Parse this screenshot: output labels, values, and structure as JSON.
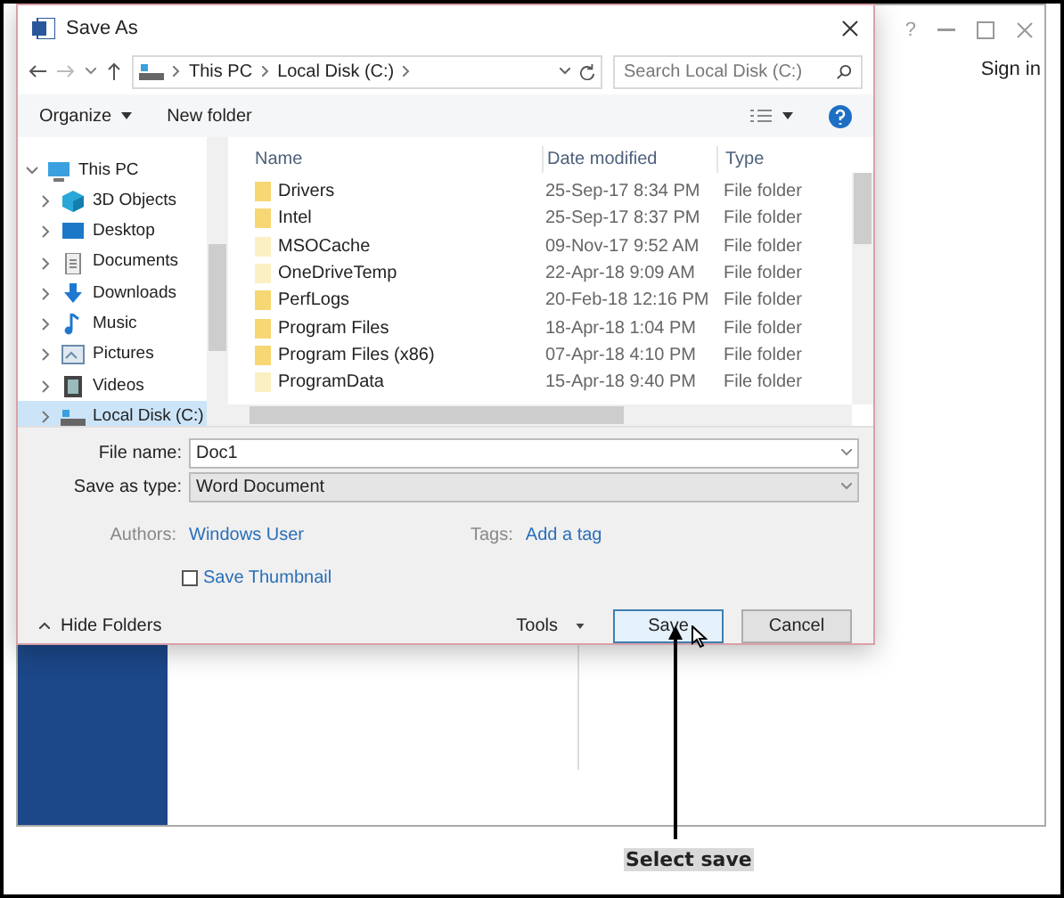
{
  "background_window": {
    "help": "?",
    "sign_in": "Sign in"
  },
  "dialog": {
    "title": "Save As",
    "path": [
      "This PC",
      "Local Disk (C:)"
    ],
    "search": {
      "placeholder": "Search Local Disk (C:)"
    },
    "toolbar": [
      "Organize",
      "New folder"
    ],
    "nav": [
      {
        "label": "This PC",
        "kind": "pc",
        "expanded": true,
        "selected": false,
        "children": [
          {
            "label": "3D Objects",
            "kind": "cube",
            "expanded": false,
            "selected": false
          },
          {
            "label": "Desktop",
            "kind": "desktop",
            "expanded": false,
            "selected": false
          },
          {
            "label": "Documents",
            "kind": "documents",
            "expanded": false,
            "selected": false
          },
          {
            "label": "Downloads",
            "kind": "downloads",
            "expanded": false,
            "selected": false
          },
          {
            "label": "Music",
            "kind": "music",
            "expanded": false,
            "selected": false
          },
          {
            "label": "Pictures",
            "kind": "pictures",
            "expanded": false,
            "selected": false
          },
          {
            "label": "Videos",
            "kind": "videos",
            "expanded": false,
            "selected": false
          },
          {
            "label": "Local Disk (C:)",
            "kind": "drive",
            "expanded": false,
            "selected": true
          }
        ]
      }
    ],
    "columns": [
      "Name",
      "Date modified",
      "Type"
    ],
    "files": [
      {
        "name": "Drivers",
        "date": "25-Sep-17 8:34 PM",
        "type": "File folder",
        "faded": false
      },
      {
        "name": "Intel",
        "date": "25-Sep-17 8:37 PM",
        "type": "File folder",
        "faded": false
      },
      {
        "name": "MSOCache",
        "date": "09-Nov-17 9:52 AM",
        "type": "File folder",
        "faded": true
      },
      {
        "name": "OneDriveTemp",
        "date": "22-Apr-18 9:09 AM",
        "type": "File folder",
        "faded": true
      },
      {
        "name": "PerfLogs",
        "date": "20-Feb-18 12:16 PM",
        "type": "File folder",
        "faded": false
      },
      {
        "name": "Program Files",
        "date": "18-Apr-18 1:04 PM",
        "type": "File folder",
        "faded": false
      },
      {
        "name": "Program Files (x86)",
        "date": "07-Apr-18 4:10 PM",
        "type": "File folder",
        "faded": false
      },
      {
        "name": "ProgramData",
        "date": "15-Apr-18 9:40 PM",
        "type": "File folder",
        "faded": true
      }
    ],
    "file_name": {
      "label": "File name:",
      "value": "Doc1"
    },
    "save_type": {
      "label": "Save as type:",
      "value": "Word Document"
    },
    "authors": {
      "label": "Authors:",
      "value": "Windows User"
    },
    "tags": {
      "label": "Tags:",
      "value": "Add a tag"
    },
    "save_thumbnail": {
      "label": "Save Thumbnail",
      "checked": false
    },
    "hide_folders": "Hide Folders",
    "tools": "Tools",
    "save": "Save",
    "cancel": "Cancel"
  },
  "callout": "Select save"
}
